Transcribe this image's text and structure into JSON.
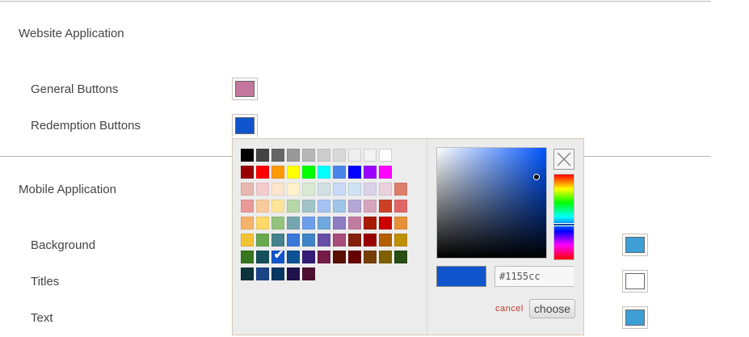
{
  "website": {
    "title": "Website Application",
    "rows": [
      {
        "label": "General Buttons",
        "color": "#c4779c"
      },
      {
        "label": "Redemption Buttons",
        "color": "#1155cc"
      }
    ]
  },
  "mobile": {
    "title": "Mobile Application",
    "rows": [
      {
        "label": "Background",
        "color": "#3d9fd6"
      },
      {
        "label": "Titles",
        "color": "#ffffff"
      },
      {
        "label": "Text",
        "color": "#3d9fd6"
      }
    ]
  },
  "picker": {
    "palette": [
      [
        "#000000",
        "#434343",
        "#666666",
        "#999999",
        "#b7b7b7",
        "#cccccc",
        "#d9d9d9",
        "#efefef",
        "#f3f3f3",
        "#ffffff"
      ],
      [
        "#980000",
        "#ff0000",
        "#ff9900",
        "#ffff00",
        "#00ff00",
        "#00ffff",
        "#4a86e8",
        "#0000ff",
        "#9900ff",
        "#ff00ff"
      ],
      [
        "#e6b8af",
        "#f4cccc",
        "#fce5cd",
        "#fff2cc",
        "#d9ead3",
        "#d0e0e3",
        "#c9daf8",
        "#cfe2f3",
        "#d9d2e9",
        "#ead1dc",
        "#dd7e6b"
      ],
      [
        "#ea9999",
        "#f9cb9c",
        "#ffe599",
        "#b6d7a8",
        "#a2c4c9",
        "#a4c2f4",
        "#9fc5e8",
        "#b4a7d6",
        "#d5a6bd",
        "#cc4125",
        "#e06666"
      ],
      [
        "#f6b26b",
        "#ffd966",
        "#93c47d",
        "#76a5af",
        "#6d9eeb",
        "#6fa8dc",
        "#8e7cc3",
        "#c27ba0",
        "#a61c00",
        "#cc0000",
        "#e69138"
      ],
      [
        "#f1c232",
        "#6aa84f",
        "#45818e",
        "#3c78d8",
        "#3d85c6",
        "#674ea7",
        "#a64d79",
        "#85200c",
        "#990000",
        "#b45f06",
        "#bf9000"
      ],
      [
        "#38761d",
        "#134f5c",
        "#1155cc",
        "#0b5394",
        "#351c75",
        "#741b47",
        "#5b0f00",
        "#660000",
        "#783f04",
        "#7f6000",
        "#274e13"
      ],
      [
        "#0c343d",
        "#1c4587",
        "#073763",
        "#20124d",
        "#4c1130"
      ]
    ],
    "selected_row": 6,
    "selected_col": 2,
    "current_color": "#1155cc",
    "hex_value": "#1155cc",
    "cancel_label": "cancel",
    "choose_label": "choose"
  }
}
